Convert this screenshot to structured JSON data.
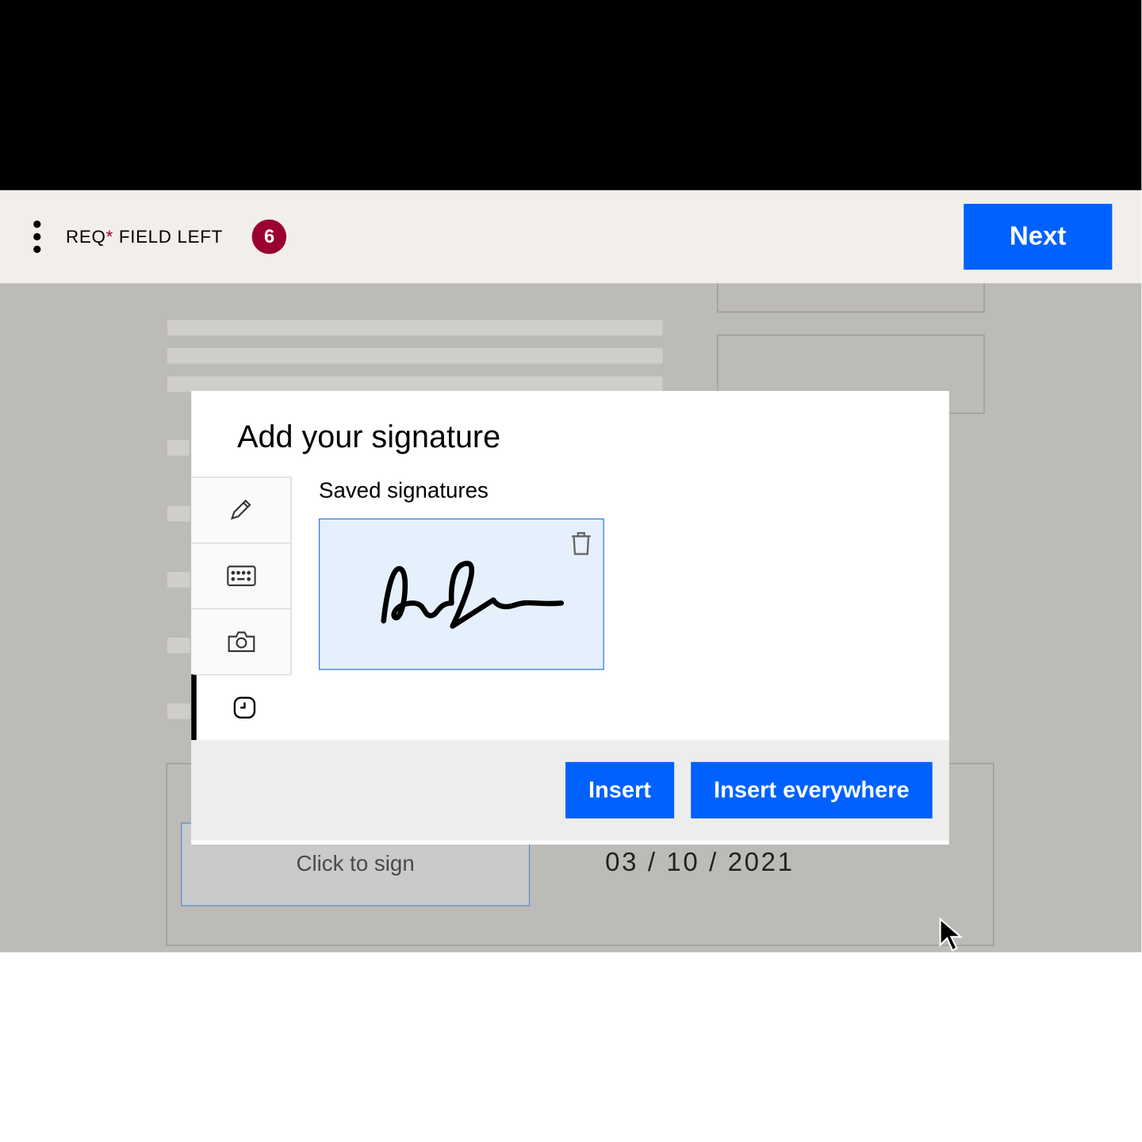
{
  "toolbar": {
    "req_prefix": "REQ",
    "req_suffix": " FIELD LEFT",
    "req_asterisk": "*",
    "req_count": "6",
    "next_label": "Next"
  },
  "modal": {
    "title": "Add your signature",
    "saved_label": "Saved signatures",
    "insert_label": "Insert",
    "insert_all_label": "Insert everywhere",
    "tabs": {
      "draw": "pencil-icon",
      "type": "keyboard-icon",
      "photo": "camera-icon",
      "saved": "clock-icon"
    }
  },
  "document": {
    "sign_placeholder": "Click to sign",
    "date_value": "03 / 10 / 2021"
  }
}
